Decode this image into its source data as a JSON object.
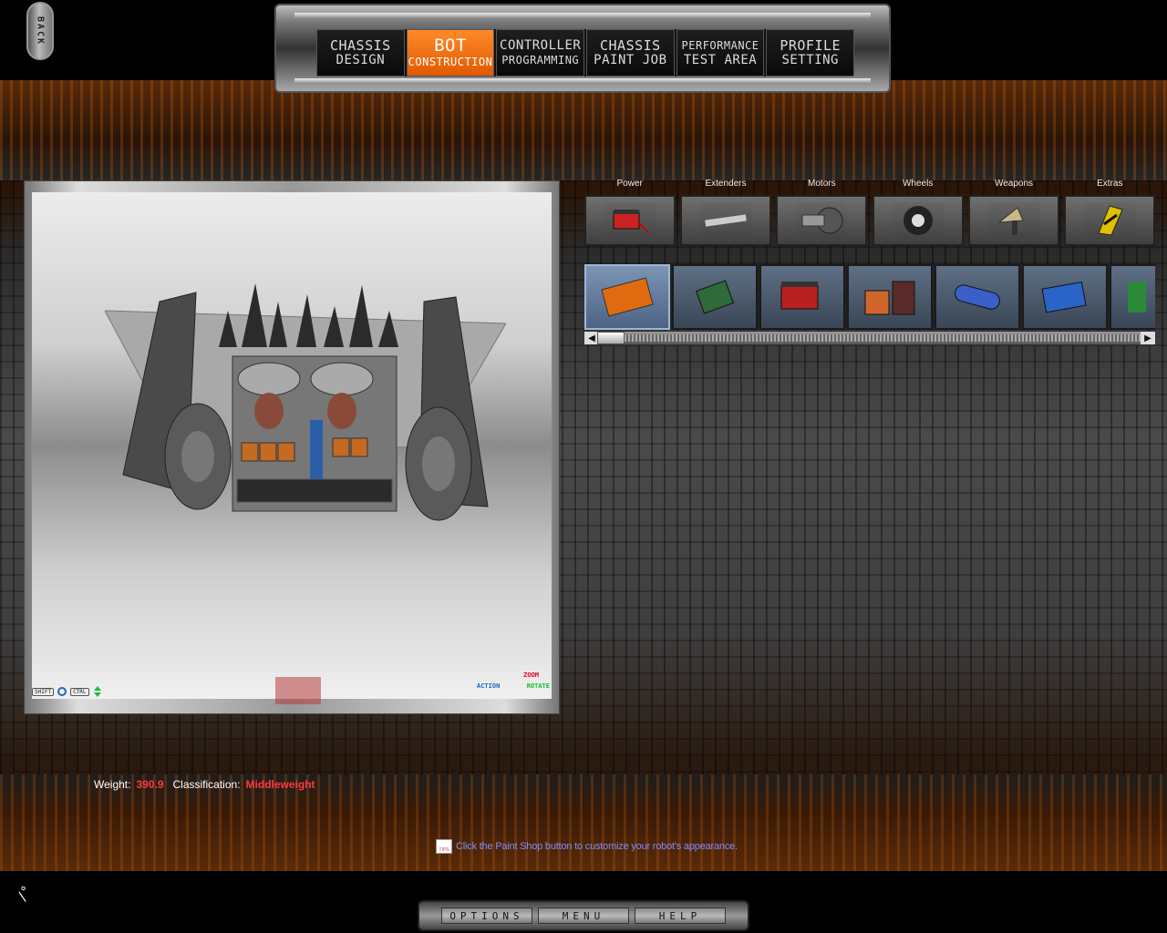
{
  "back_button": {
    "label": "BACK"
  },
  "top_nav": {
    "tabs": [
      {
        "line1": "CHASSIS",
        "line2": "DESIGN",
        "active": false
      },
      {
        "line1": "BOT",
        "line2": "CONSTRUCTION",
        "active": true
      },
      {
        "line1": "CONTROLLER",
        "line2": "PROGRAMMING",
        "active": false
      },
      {
        "line1": "CHASSIS",
        "line2": "PAINT JOB",
        "active": false
      },
      {
        "line1": "PERFORMANCE",
        "line2": "TEST AREA",
        "active": false
      },
      {
        "line1": "PROFILE",
        "line2": "SETTING",
        "active": false
      }
    ]
  },
  "viewport": {
    "controls": {
      "shift_key": "SHIFT",
      "ctrl_key": "CTRL"
    },
    "legend": {
      "zoom": "ZOOM",
      "action": "ACTION",
      "rotate": "ROTATE"
    }
  },
  "categories": [
    {
      "label": "Power",
      "icon": "battery-icon"
    },
    {
      "label": "Extenders",
      "icon": "extender-bar-icon"
    },
    {
      "label": "Motors",
      "icon": "motor-icon"
    },
    {
      "label": "Wheels",
      "icon": "wheel-icon"
    },
    {
      "label": "Weapons",
      "icon": "weapon-icon"
    },
    {
      "label": "Extras",
      "icon": "extras-icon"
    }
  ],
  "parts": [
    {
      "icon": "orange-battery-pack-icon",
      "selected": true
    },
    {
      "icon": "circuit-board-icon",
      "selected": false
    },
    {
      "icon": "red-battery-icon",
      "selected": false
    },
    {
      "icon": "battery-cells-icon",
      "selected": false
    },
    {
      "icon": "blue-cell-icon",
      "selected": false
    },
    {
      "icon": "blue-controller-icon",
      "selected": false
    },
    {
      "icon": "green-part-icon",
      "selected": false
    }
  ],
  "stats": {
    "weight_label": "Weight:",
    "weight_value": "390.9",
    "class_label": "Classification:",
    "class_value": "Middleweight"
  },
  "hint": {
    "tips_label": "TIPS",
    "text": "Click the Paint Shop button to customize your robot's appearance."
  },
  "bottom_nav": {
    "options": "OPTIONS",
    "menu": "MENU",
    "help": "HELP"
  },
  "colors": {
    "accent": "#f26a10",
    "value_red": "#ff3a3a",
    "hint_blue": "#7f8cff"
  }
}
